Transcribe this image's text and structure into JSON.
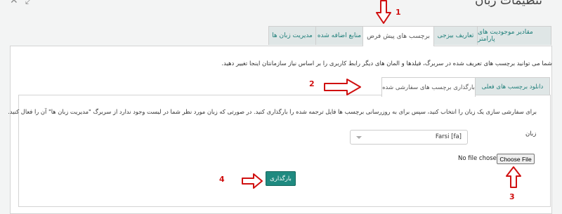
{
  "header": {
    "title": "تنظیمات زبان",
    "window_icons": [
      "close-icon",
      "expand-icon"
    ]
  },
  "tabs": [
    {
      "label": "مقادیر موجودیت های پارامتر"
    },
    {
      "label": "تعاریف بیزجی"
    },
    {
      "label": "برچسب های پیش فرض",
      "active": true
    },
    {
      "label": "منابع اضافه شده"
    },
    {
      "label": "مدیریت زبان ها"
    }
  ],
  "intro_text": "شما می توانید برچسب های تعریف شده در سربرگ، فیلدها و المان های دیگر رابط کاربری را بر اساس نیاز سازمانتان اینجا تغییر دهید.",
  "subtabs": [
    {
      "label": "دانلود برچسب های فعلی",
      "active": false
    },
    {
      "label": "بارگذاری برچسب های سفارشی شده",
      "active": true
    }
  ],
  "subpanel": {
    "instructions": "برای سفارشی سازی یک زبان را انتخاب کنید، سپس برای به روزرسانی برچسب ها فایل ترجمه شده را بارگذاری کنید. در صورتی که زبان مورد نظر شما در لیست وجود ندارد از سربرگ \"مدیریت زبان ها\" آن را فعال کنید.",
    "language_label": "زبان",
    "language_value": "Farsi [fa]",
    "file_status": "No file chosen",
    "choose_file_label": "Choose File",
    "upload_label": "بارگذاری"
  },
  "annotations": [
    {
      "number": "1"
    },
    {
      "number": "2"
    },
    {
      "number": "3"
    },
    {
      "number": "4"
    }
  ],
  "colors": {
    "accent": "#1f8a80",
    "annotation": "#d01010",
    "tab_bg": "#dfe6e6"
  }
}
